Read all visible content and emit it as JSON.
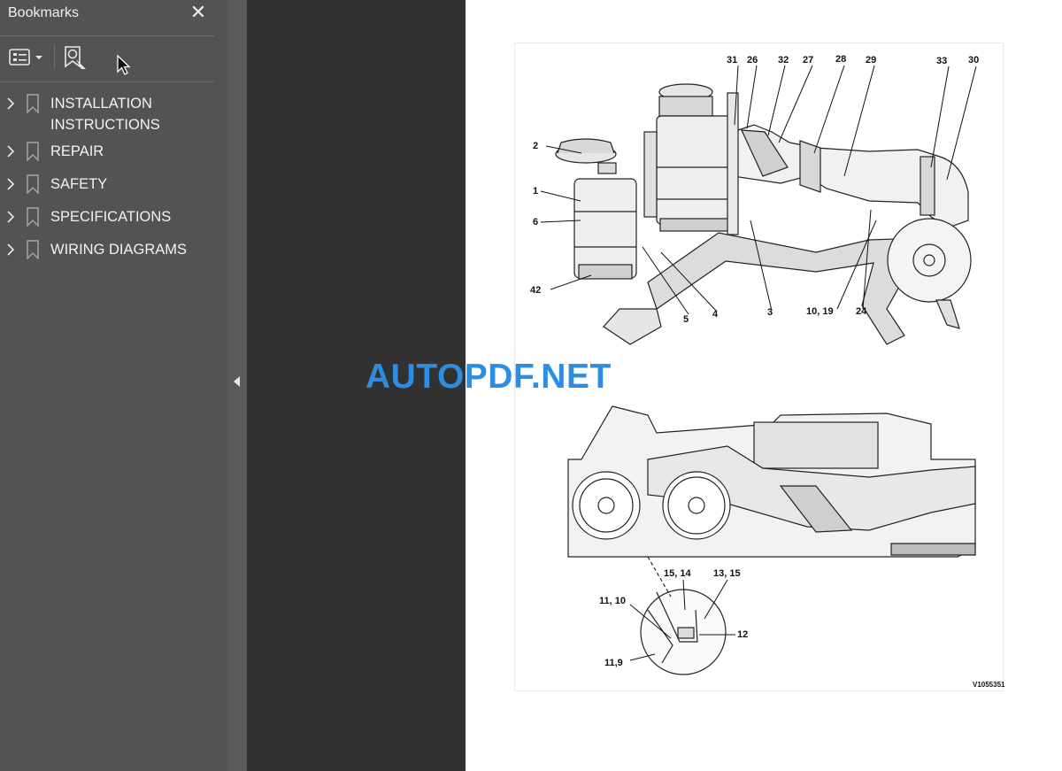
{
  "sidebar": {
    "title": "Bookmarks",
    "close_glyph": "✕",
    "toolbar": {
      "options_icon": "list-options-icon",
      "find_icon": "find-bookmark-icon"
    },
    "bookmarks": [
      {
        "label": "INSTALLATION\nINSTRUCTIONS"
      },
      {
        "label": "REPAIR"
      },
      {
        "label": "SAFETY"
      },
      {
        "label": "SPECIFICATIONS"
      },
      {
        "label": "WIRING DIAGRAMS"
      }
    ]
  },
  "figure": {
    "callouts": [
      "31",
      "26",
      "32",
      "27",
      "28",
      "29",
      "33",
      "30",
      "2",
      "1",
      "6",
      "42",
      "5",
      "4",
      "3",
      "10, 19",
      "24",
      "15, 14",
      "13, 15",
      "11, 10",
      "12",
      "11,9"
    ],
    "code": "V1055351"
  },
  "watermark": "AUTOPDF.NET",
  "colors": {
    "sidebar": "#535353",
    "workspace": "#323232",
    "page": "#ffffff",
    "watermark": "#2f8de0"
  }
}
